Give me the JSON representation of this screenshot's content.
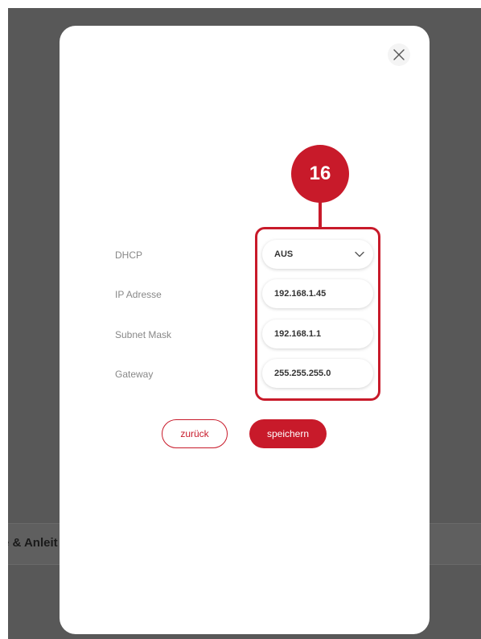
{
  "background": {
    "partial_text": "e & Anleit"
  },
  "dialog": {
    "close_icon": "close-icon",
    "badge_number": "16",
    "fields": {
      "dhcp": {
        "label": "DHCP",
        "value": "AUS",
        "icon": "chevron-down-icon"
      },
      "ip": {
        "label": "IP Adresse",
        "value": "192.168.1.45"
      },
      "subnet": {
        "label": "Subnet Mask",
        "value": "192.168.1.1"
      },
      "gateway": {
        "label": "Gateway",
        "value": "255.255.255.0"
      }
    },
    "buttons": {
      "back": "zurück",
      "save": "speichern"
    }
  },
  "colors": {
    "accent": "#c81a2a",
    "overlay": "#585858",
    "label": "#888888",
    "value": "#333333"
  }
}
